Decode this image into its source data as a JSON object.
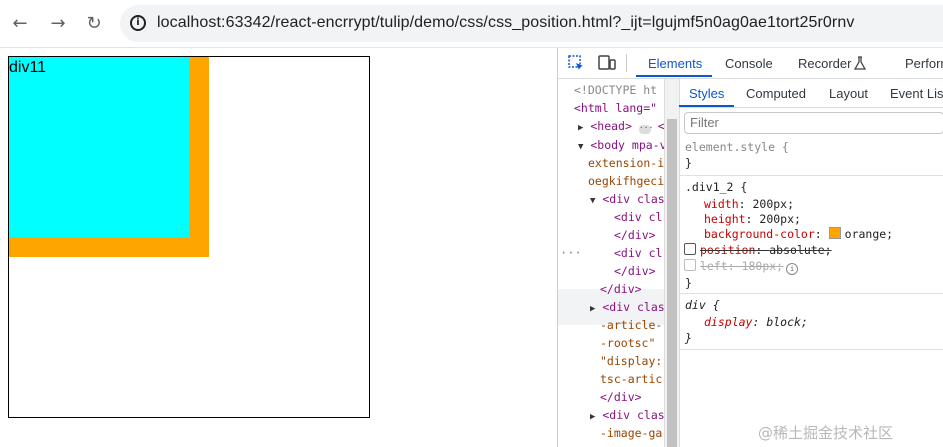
{
  "browser": {
    "back_icon": "arrow-left-icon",
    "forward_icon": "arrow-right-icon",
    "reload_icon": "reload-icon",
    "info_icon": "info-icon",
    "url": "localhost:63342/react-encrrypt/tulip/demo/css/css_position.html?_ijt=lgujmf5n0ag0ae1tort25r0rnv"
  },
  "page": {
    "div11_text": "div11"
  },
  "devtools": {
    "tabs": [
      "Elements",
      "Console",
      "Recorder",
      "Perform"
    ],
    "active_tab": "Elements",
    "dom": {
      "doctype": "<!DOCTYPE ht",
      "html_open": "<html lang=\"",
      "head": "<head>",
      "head_close": "</",
      "body_open": "<body mpa-v",
      "body_attr1": "extension-i",
      "body_attr2": "oegkifhgeci",
      "div_clas_1": "<div clas",
      "div_cl_1": "<div cl",
      "div_close_1": "</div>",
      "div_cl_2": "<div cl",
      "div_close_2": "</div>",
      "div_close_3": "</div>",
      "div_clas_2": "<div clas",
      "article": "-article-",
      "rootsc": "-rootsc\"",
      "display": "\"display:",
      "tsc_artic": "tsc-artic",
      "div_close_4": "</div>",
      "div_clas_3": "<div clas",
      "image_ga": "-image-ga"
    },
    "styles": {
      "sub_tabs": [
        "Styles",
        "Computed",
        "Layout",
        "Event List"
      ],
      "filter_placeholder": "Filter",
      "element_style": "element.style {",
      "close_brace": "}",
      "rule1_selector": ".div1_2 {",
      "rule1_props": [
        {
          "name": "width",
          "value": "200px;"
        },
        {
          "name": "height",
          "value": "200px;"
        },
        {
          "name": "background-color",
          "value": "orange;"
        },
        {
          "name": "position",
          "value": "absolute;"
        },
        {
          "name": "left",
          "value": "180px;"
        }
      ],
      "rule2_selector": "div {",
      "rule2_prop": {
        "name": "display",
        "value": "block;"
      }
    }
  },
  "watermark": "@稀土掘金技术社区",
  "colors": {
    "orange": "#ffa500",
    "cyan": "#00ffff",
    "accent": "#0b57d0"
  }
}
